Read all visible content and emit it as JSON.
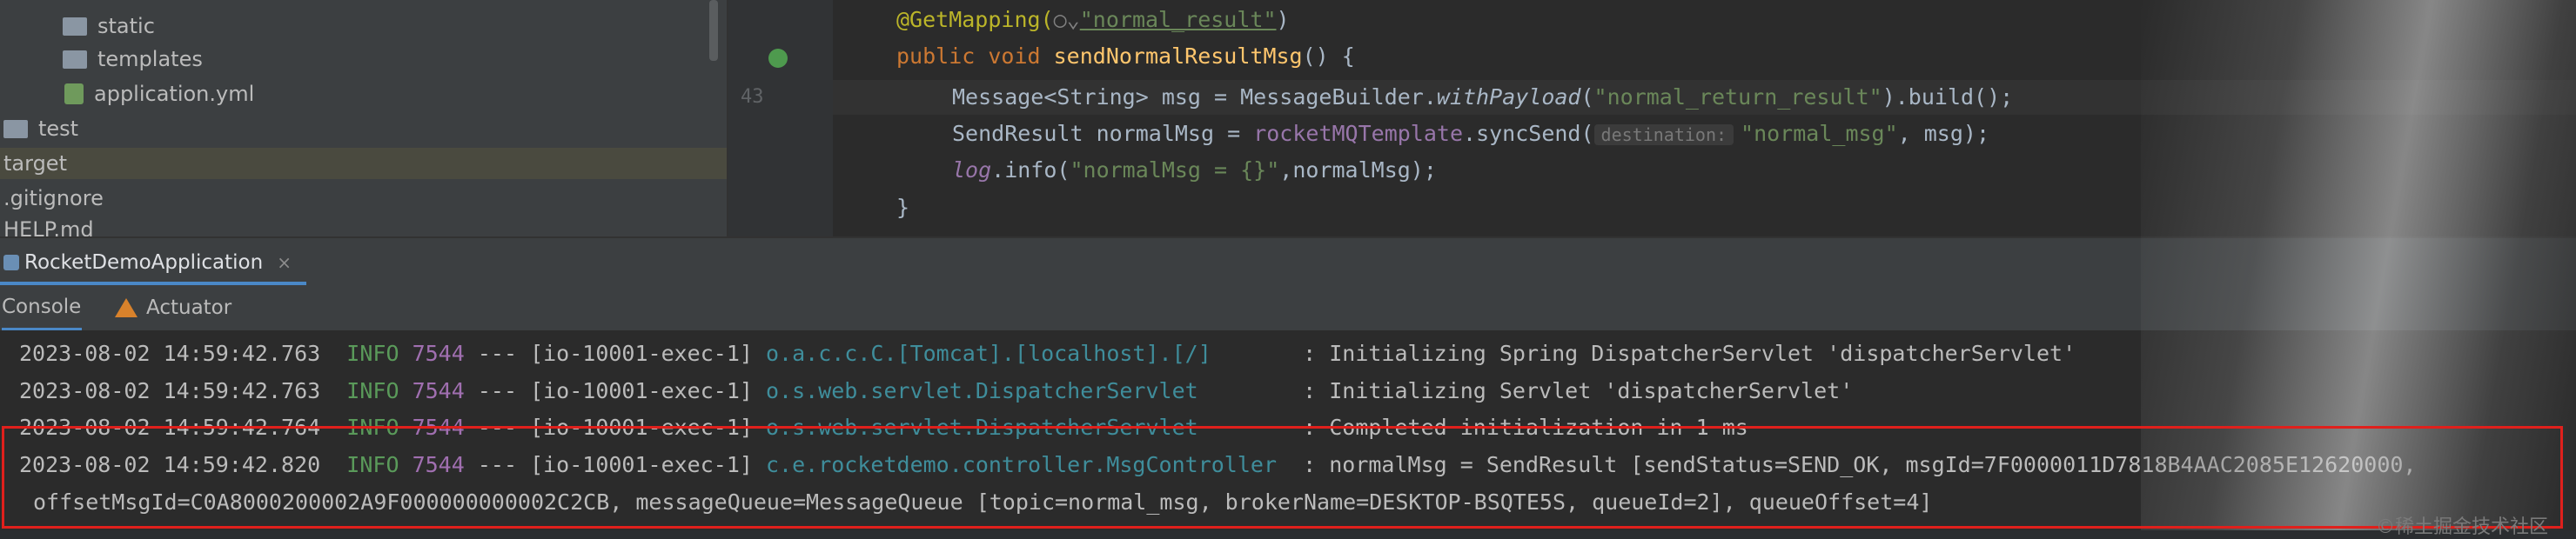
{
  "project_tree": {
    "items": [
      {
        "label": "static",
        "type": "folder"
      },
      {
        "label": "templates",
        "type": "folder"
      },
      {
        "label": "application.yml",
        "type": "yml-file"
      },
      {
        "label": "test",
        "type": "folder"
      },
      {
        "label": "target",
        "type": "folder",
        "selected": true
      },
      {
        "label": ".gitignore",
        "type": "file"
      },
      {
        "label": "HELP.md",
        "type": "file"
      }
    ]
  },
  "editor": {
    "line_number": "43",
    "annotation": "@GetMapping(",
    "annotation_value": "\"normal_result\"",
    "annotation_close": ")",
    "method_signature_kw": "public void ",
    "method_name": "sendNormalResultMsg",
    "method_signature_end": "() {",
    "line1": {
      "prefix": "Message<String> msg = MessageBuilder.",
      "call": "withPayload",
      "arg": "\"normal_return_result\"",
      "suffix": ").build();"
    },
    "line2": {
      "prefix": "SendResult normalMsg = ",
      "field": "rocketMQTemplate",
      "call": ".syncSend(",
      "hint": "destination:",
      "arg": "\"normal_msg\"",
      "suffix": ", msg);"
    },
    "line3": {
      "field": "log",
      "call": ".info(",
      "arg": "\"normalMsg = {}\"",
      "suffix": ",normalMsg);"
    },
    "closing_brace": "}"
  },
  "run_window": {
    "tab_label": "RocketDemoApplication",
    "close_glyph": "×",
    "sub_tabs": [
      "Console",
      "Actuator"
    ]
  },
  "console": {
    "lines": [
      {
        "ts": "2023-08-02 14:59:42.763",
        "level": "INFO",
        "pid": "7544",
        "thread": "--- [io-10001-exec-1]",
        "logger": "o.a.c.c.C.[Tomcat].[localhost].[/]      ",
        "msg": " : Initializing Spring DispatcherServlet 'dispatcherServlet'"
      },
      {
        "ts": "2023-08-02 14:59:42.763",
        "level": "INFO",
        "pid": "7544",
        "thread": "--- [io-10001-exec-1]",
        "logger": "o.s.web.servlet.DispatcherServlet       ",
        "msg": " : Initializing Servlet 'dispatcherServlet'"
      },
      {
        "ts": "2023-08-02 14:59:42.764",
        "level": "INFO",
        "pid": "7544",
        "thread": "--- [io-10001-exec-1]",
        "logger": "o.s.web.servlet.DispatcherServlet       ",
        "msg": " : Completed initialization in 1 ms"
      },
      {
        "ts": "2023-08-02 14:59:42.820",
        "level": "INFO",
        "pid": "7544",
        "thread": "--- [io-10001-exec-1]",
        "logger": "c.e.rocketdemo.controller.MsgController ",
        "msg": " : normalMsg = SendResult [sendStatus=SEND_OK, msgId=7F0000011D7818B4AAC2085E12620000,"
      }
    ],
    "continuation": "offsetMsgId=C0A8000200002A9F000000000002C2CB, messageQueue=MessageQueue [topic=normal_msg, brokerName=DESKTOP-BSQTE5S, queueId=2], queueOffset=4]"
  },
  "watermark": "©稀土掘金技术社区"
}
